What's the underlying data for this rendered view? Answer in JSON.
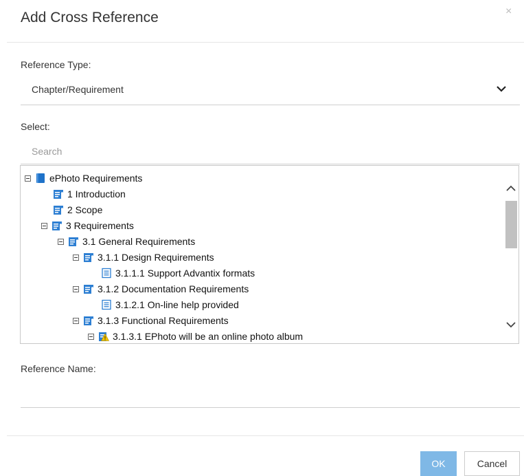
{
  "dialog": {
    "title": "Add Cross Reference",
    "close_glyph": "×"
  },
  "reference_type": {
    "label": "Reference Type:",
    "value": "Chapter/Requirement"
  },
  "select": {
    "label": "Select:",
    "search_placeholder": "Search"
  },
  "tree": {
    "items": [
      {
        "label": "ePhoto Requirements",
        "icon": "book-icon"
      },
      {
        "label": "1 Introduction",
        "icon": "chapter-icon"
      },
      {
        "label": "2 Scope",
        "icon": "chapter-icon"
      },
      {
        "label": "3 Requirements",
        "icon": "chapter-icon"
      },
      {
        "label": "3.1 General Requirements",
        "icon": "chapter-icon"
      },
      {
        "label": "3.1.1 Design Requirements",
        "icon": "chapter-icon"
      },
      {
        "label": "3.1.1.1 Support Advantix formats",
        "icon": "requirement-icon"
      },
      {
        "label": "3.1.2 Documentation Requirements",
        "icon": "chapter-icon"
      },
      {
        "label": "3.1.2.1 On-line help provided",
        "icon": "requirement-icon"
      },
      {
        "label": "3.1.3 Functional Requirements",
        "icon": "chapter-icon"
      },
      {
        "label": "3.1.3.1 EPhoto will be an online photo album",
        "icon": "warning-requirement-icon"
      }
    ]
  },
  "reference_name": {
    "label": "Reference Name:",
    "value": ""
  },
  "buttons": {
    "ok": "OK",
    "cancel": "Cancel"
  },
  "colors": {
    "accent": "#2d7fd3",
    "ok_button": "#7fb8e6",
    "warning": "#f2c200"
  }
}
